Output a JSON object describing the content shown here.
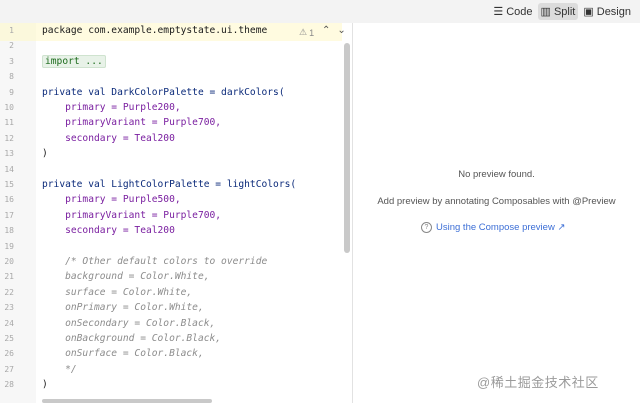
{
  "toolbar": {
    "modes": [
      {
        "icon": "lines-icon",
        "label": "Code"
      },
      {
        "icon": "split-icon",
        "label": "Split"
      },
      {
        "icon": "image-icon",
        "label": "Design"
      }
    ]
  },
  "editor": {
    "warning_count": "1",
    "line_numbers": [
      "1",
      "2",
      "3",
      "8",
      "9",
      "10",
      "11",
      "12",
      "13",
      "14",
      "15",
      "16",
      "17",
      "18",
      "19",
      "20",
      "21",
      "22",
      "23",
      "24",
      "25",
      "26",
      "27",
      "28"
    ],
    "lines": [
      "package com.example.emptystate.ui.theme",
      "",
      "import ...",
      "",
      "private val DarkColorPalette = darkColors(",
      "    primary = Purple200,",
      "    primaryVariant = Purple700,",
      "    secondary = Teal200",
      ")",
      "",
      "private val LightColorPalette = lightColors(",
      "    primary = Purple500,",
      "    primaryVariant = Purple700,",
      "    secondary = Teal200",
      "",
      "    /* Other default colors to override",
      "    background = Color.White,",
      "    surface = Color.White,",
      "    onPrimary = Color.White,",
      "    onSecondary = Color.Black,",
      "    onBackground = Color.Black,",
      "    onSurface = Color.Black,",
      "    */",
      ")"
    ]
  },
  "preview": {
    "no_preview": "No preview found.",
    "hint": "Add preview by annotating Composables with @Preview",
    "link": "Using the Compose preview ↗"
  },
  "watermark": "@稀土掘金技术社区"
}
